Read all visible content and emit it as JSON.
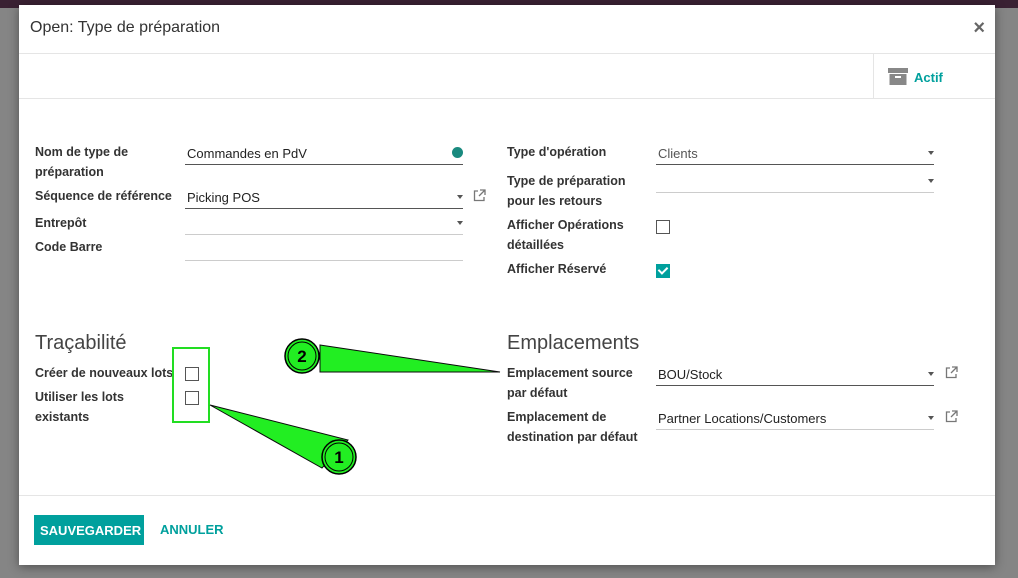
{
  "modal": {
    "title": "Open: Type de préparation",
    "close_glyph": "×",
    "active_label": "Actif"
  },
  "form": {
    "left": [
      {
        "label": "Nom de type de préparation",
        "value": "Commandes en PdV"
      },
      {
        "label": "Séquence de référence",
        "value": "Picking POS"
      },
      {
        "label": "Entrepôt",
        "value": ""
      },
      {
        "label": "Code Barre",
        "value": ""
      }
    ],
    "right": [
      {
        "label": "Type d'opération",
        "value": "Clients"
      },
      {
        "label": "Type de préparation pour les retours",
        "value": ""
      },
      {
        "label": "Afficher Opérations détaillées",
        "checked": false
      },
      {
        "label": "Afficher Réservé",
        "checked": true
      }
    ]
  },
  "tracability": {
    "title": "Traçabilité",
    "create_lots_label": "Créer de nouveaux lots",
    "create_lots_checked": false,
    "use_existing_lots_label": "Utiliser les lots existants",
    "use_existing_lots_checked": false
  },
  "locations": {
    "title": "Emplacements",
    "source_label": "Emplacement source par défaut",
    "source_value": "BOU/Stock",
    "dest_label": "Emplacement de destination par défaut",
    "dest_value": "Partner Locations/Customers"
  },
  "footer": {
    "save_label": "SAUVEGARDER",
    "cancel_label": "ANNULER"
  },
  "annotations": [
    {
      "number": "1"
    },
    {
      "number": "2"
    }
  ],
  "colors": {
    "accent": "#00a09d",
    "highlight": "#22dd22"
  }
}
